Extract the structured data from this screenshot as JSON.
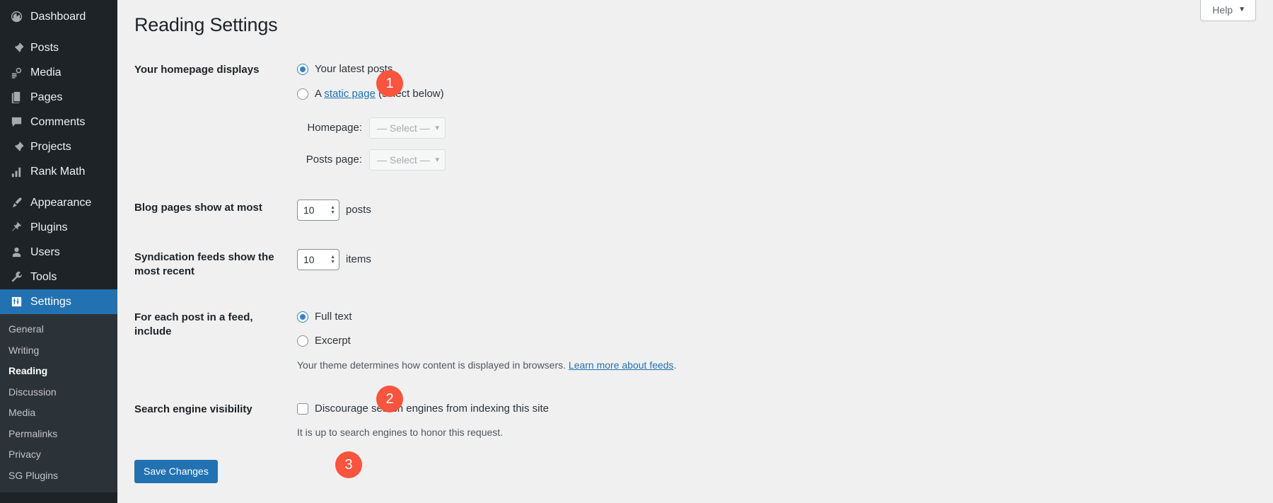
{
  "sidebar": {
    "items": [
      {
        "label": "Dashboard",
        "icon": "dashboard-icon"
      },
      {
        "label": "Posts",
        "icon": "pin-icon"
      },
      {
        "label": "Media",
        "icon": "media-icon"
      },
      {
        "label": "Pages",
        "icon": "pages-icon"
      },
      {
        "label": "Comments",
        "icon": "comment-icon"
      },
      {
        "label": "Projects",
        "icon": "pin-icon"
      },
      {
        "label": "Rank Math",
        "icon": "chart-icon"
      },
      {
        "label": "Appearance",
        "icon": "brush-icon"
      },
      {
        "label": "Plugins",
        "icon": "plug-icon"
      },
      {
        "label": "Users",
        "icon": "user-icon"
      },
      {
        "label": "Tools",
        "icon": "wrench-icon"
      },
      {
        "label": "Settings",
        "icon": "settings-icon"
      }
    ],
    "submenu": [
      {
        "label": "General"
      },
      {
        "label": "Writing"
      },
      {
        "label": "Reading"
      },
      {
        "label": "Discussion"
      },
      {
        "label": "Media"
      },
      {
        "label": "Permalinks"
      },
      {
        "label": "Privacy"
      },
      {
        "label": "SG Plugins"
      }
    ],
    "active_item": "Settings",
    "active_submenu": "Reading",
    "colors": {
      "background": "#1d2327",
      "submenu_background": "#2c3338",
      "active": "#2271b1",
      "text": "#f0f0f1"
    }
  },
  "header": {
    "help_label": "Help",
    "help_caret": "▼"
  },
  "page": {
    "title": "Reading Settings",
    "accent_color": "#2271b1",
    "badge_color": "#f9543d"
  },
  "homepage_section": {
    "label": "Your homepage displays",
    "options": [
      {
        "label": "Your latest posts",
        "checked": true
      },
      {
        "label_pre": "A ",
        "link": "static page",
        "label_post": " (select below)",
        "checked": false
      }
    ],
    "selects": [
      {
        "label": "Homepage:",
        "value": "— Select —"
      },
      {
        "label": "Posts page:",
        "value": "— Select —"
      }
    ]
  },
  "blog_pages": {
    "label": "Blog pages show at most",
    "value": "10",
    "unit": "posts"
  },
  "syndication": {
    "label": "Syndication feeds show the most recent",
    "value": "10",
    "unit": "items"
  },
  "feed_include": {
    "label": "For each post in a feed, include",
    "options": [
      {
        "label": "Full text",
        "checked": true
      },
      {
        "label": "Excerpt",
        "checked": false
      }
    ],
    "description_pre": "Your theme determines how content is displayed in browsers. ",
    "description_link": "Learn more about feeds",
    "description_post": "."
  },
  "search_visibility": {
    "label": "Search engine visibility",
    "checkbox_label": "Discourage search engines from indexing this site",
    "checked": false,
    "description": "It is up to search engines to honor this request."
  },
  "submit": {
    "label": "Save Changes"
  },
  "annotations": {
    "badge1": "1",
    "badge2": "2",
    "badge3": "3"
  }
}
